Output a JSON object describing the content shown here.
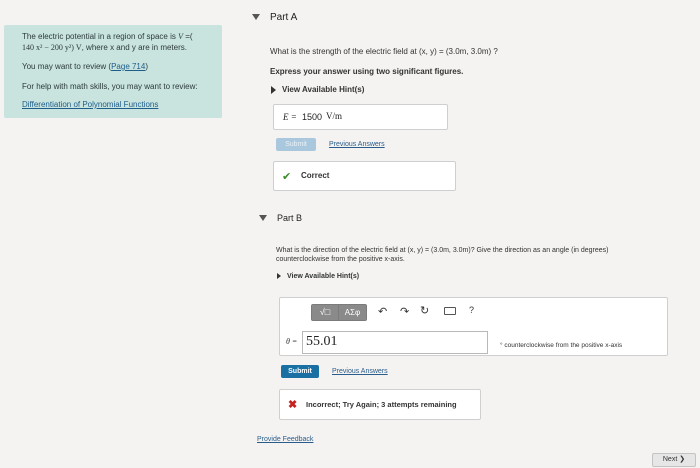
{
  "sidebar": {
    "intro_a": "The electric potential in a region of space is ",
    "intro_v": "V",
    "intro_eq": " =(",
    "intro_expr": "140 x² − 200 y²) V",
    "intro_tail": ", where x and y are in meters.",
    "review_text": "You may want to review (",
    "review_link": "Page 714",
    "review_close": ")",
    "help_text": "For help with math skills, you may want to review:",
    "help_link": "Differentiation of Polynomial Functions"
  },
  "partA": {
    "title": "Part A",
    "question": "What is the strength of the electric field at (x, y) = (3.0m, 3.0m) ?",
    "instruction": "Express your answer using two significant figures.",
    "hints": "View Available Hint(s)",
    "answer_label": "E =",
    "answer_value": "1500",
    "answer_unit": "V/m",
    "submit": "Submit",
    "previous": "Previous Answers",
    "feedback": "Correct"
  },
  "partB": {
    "title": "Part B",
    "question_line1": "What is the direction of the electric field at (x, y) = (3.0m, 3.0m)? Give the direction as an angle (in degrees)",
    "question_line2": "counterclockwise from the positive x-axis.",
    "hints": "View Available Hint(s)",
    "toolbar_sqrt": "√□",
    "toolbar_greek": "ΑΣφ",
    "toolbar_help": "?",
    "answer_label": "θ =",
    "answer_value": "55.01",
    "answer_suffix": "° counterclockwise from the positive x-axis",
    "submit": "Submit",
    "previous": "Previous Answers",
    "feedback_strong": "Incorrect; Try Again; 3 attempts remaining"
  },
  "footer": {
    "feedback_link": "Provide Feedback",
    "next": "Next"
  },
  "colors": {
    "sidebar_bg": "#c9e3df",
    "submit_blue": "#1a6fa3",
    "submit_disabled": "#a9c8dd",
    "correct_green": "#3b8a2a",
    "incorrect_red": "#c42323"
  }
}
